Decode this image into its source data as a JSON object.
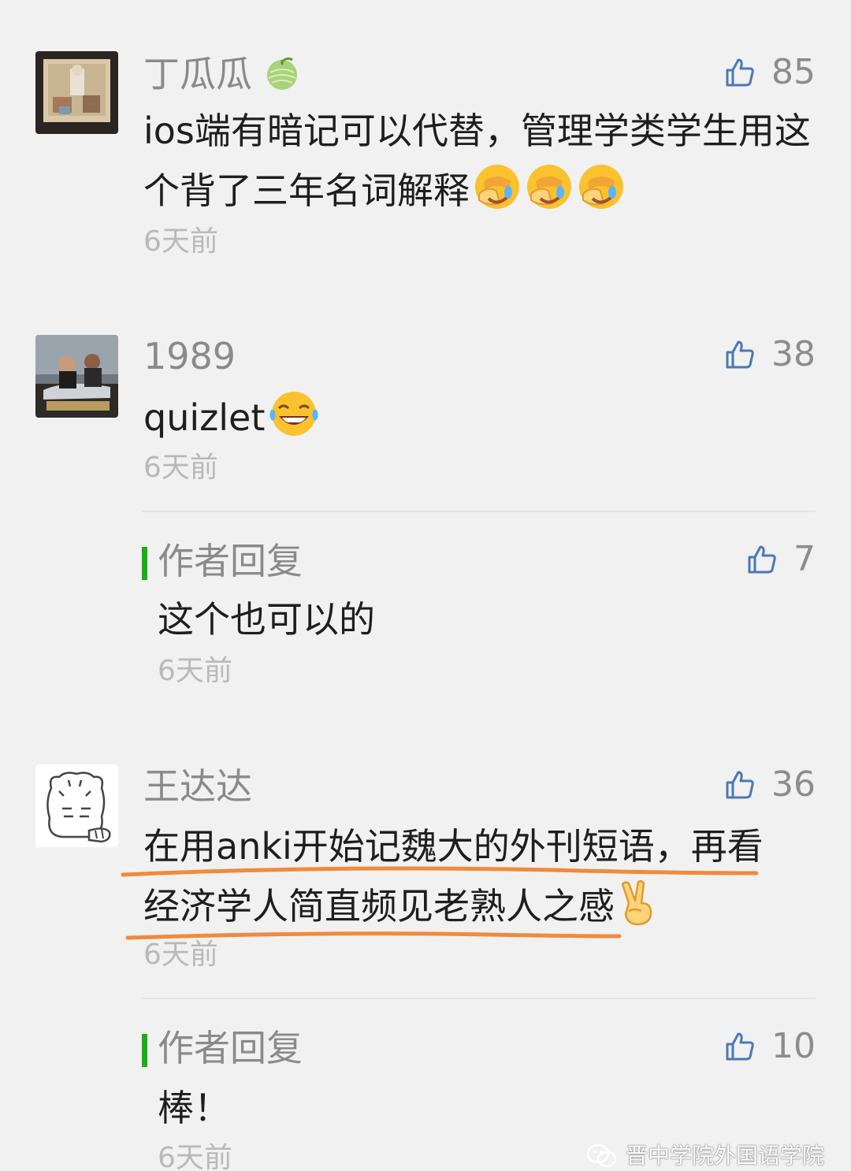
{
  "comments": [
    {
      "name": "丁瓜瓜",
      "name_emoji": "melon-emoji",
      "text": "ios端有暗记可以代替，管理学类学生用这个背了三年名词解释",
      "text_emojis": [
        "facepalm-emoji",
        "facepalm-emoji",
        "facepalm-emoji"
      ],
      "likes": "85",
      "time": "6天前"
    },
    {
      "name": "1989",
      "text": "quizlet",
      "text_emojis": [
        "tears-of-joy-emoji"
      ],
      "likes": "38",
      "time": "6天前",
      "reply": {
        "label": "作者回复",
        "text": "这个也可以的",
        "likes": "7",
        "time": "6天前"
      }
    },
    {
      "name": "王达达",
      "text": "在用anki开始记魏大的外刊短语，再看经济学人简直频见老熟人之感",
      "text_emojis": [
        "victory-hand-emoji"
      ],
      "likes": "36",
      "time": "6天前",
      "reply": {
        "label": "作者回复",
        "text": "棒！",
        "likes": "10",
        "time": "6天前"
      }
    }
  ],
  "watermark": "晋中学院外国语学院",
  "colors": {
    "background": "#f1f1f1",
    "reply_bar": "#1aad19",
    "underline": "#f08a3c",
    "meta_text": "#8a8a8a"
  }
}
